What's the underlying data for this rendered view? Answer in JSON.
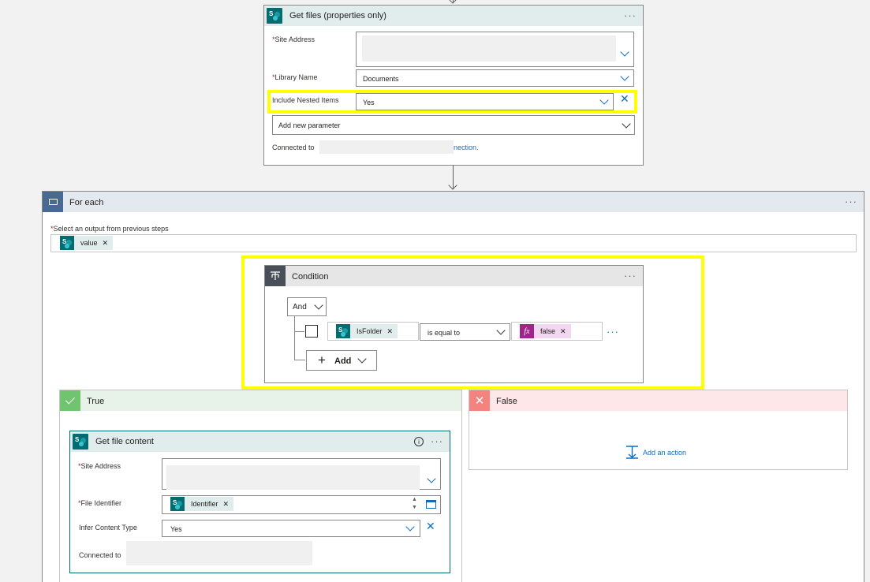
{
  "get_files": {
    "title": "Get files (properties only)",
    "site_address_label": "Site Address",
    "library_name_label": "Library Name",
    "library_name_value": "Documents",
    "include_nested_label": "Include Nested Items",
    "include_nested_value": "Yes",
    "add_param_label": "Add new parameter",
    "connected_prefix": "Connected to",
    "connected_suffix": "nection."
  },
  "for_each": {
    "title": "For each",
    "select_label": "Select an output from previous steps",
    "token_value": "value"
  },
  "condition": {
    "title": "Condition",
    "group_operator": "And",
    "left_token": "IsFolder",
    "operator": "is equal to",
    "right_token": "false",
    "right_token_icon_text": "fx",
    "add_label": "Add"
  },
  "true_branch": {
    "title": "True"
  },
  "false_branch": {
    "title": "False",
    "add_action_label": "Add an action"
  },
  "get_file_content": {
    "title": "Get file content",
    "site_address_label": "Site Address",
    "file_identifier_label": "File Identifier",
    "file_identifier_token": "Identifier",
    "infer_label": "Infer Content Type",
    "infer_value": "Yes",
    "connected_prefix": "Connected to"
  },
  "colors": {
    "sharepoint": "#036c70",
    "highlight": "#ffff00",
    "link": "#0f6cbd",
    "true_header": "#e7f3e9",
    "false_header": "#fde7e9",
    "expression": "#a0258a"
  }
}
